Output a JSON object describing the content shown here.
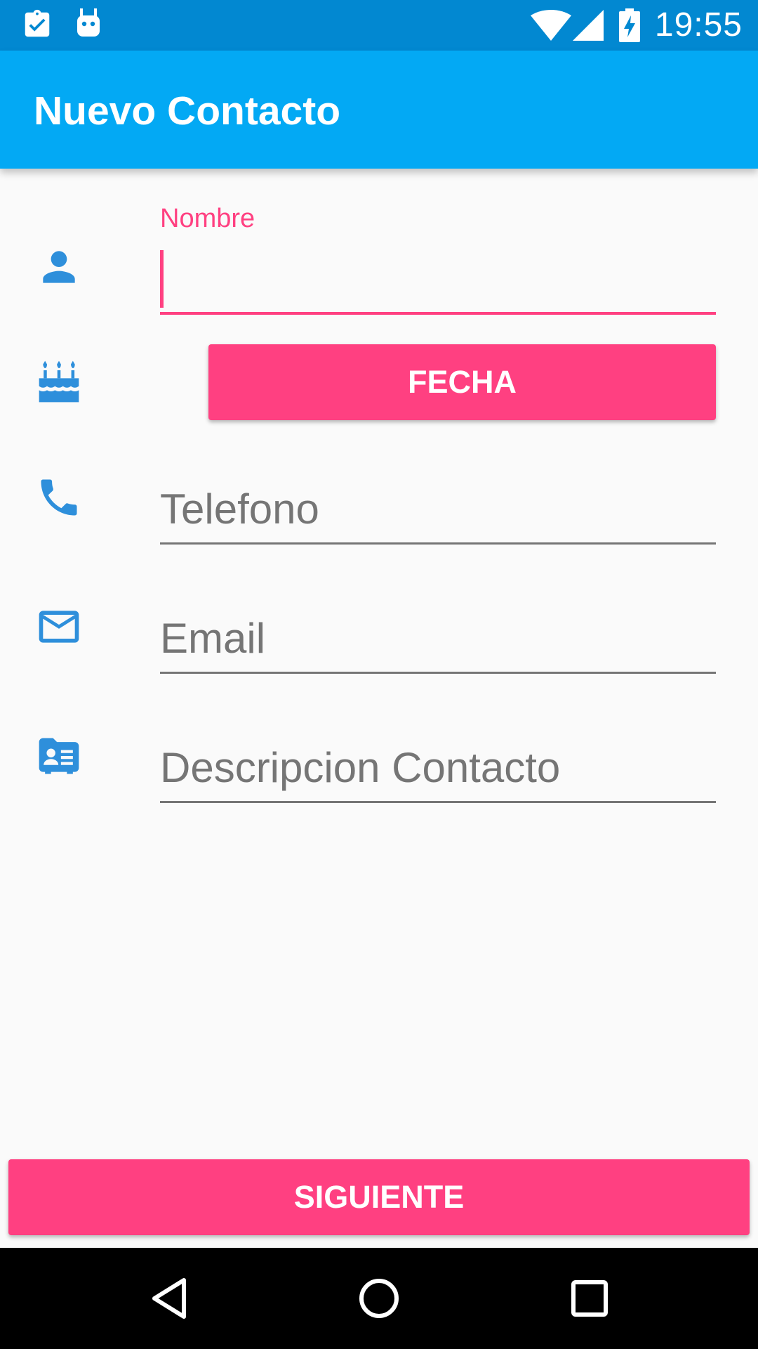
{
  "status_bar": {
    "time": "19:55",
    "icons": [
      "clipboard-check-icon",
      "android-icon",
      "wifi-icon",
      "cell-signal-icon",
      "battery-charging-icon"
    ]
  },
  "app_bar": {
    "title": "Nuevo Contacto"
  },
  "form": {
    "nombre": {
      "label": "Nombre",
      "value": ""
    },
    "fecha_button": "FECHA",
    "telefono": {
      "placeholder": "Telefono",
      "value": ""
    },
    "email": {
      "placeholder": "Email",
      "value": ""
    },
    "descripcion": {
      "placeholder": "Descripcion Contacto",
      "value": ""
    }
  },
  "footer": {
    "next_button": "SIGUIENTE"
  },
  "nav_bar": {
    "icons": [
      "back-icon",
      "home-icon",
      "recents-icon"
    ]
  },
  "colors": {
    "primary": "#03a9f4",
    "primary_dark": "#0288d1",
    "accent": "#ff4081",
    "icon_blue": "#2e8fdb"
  }
}
